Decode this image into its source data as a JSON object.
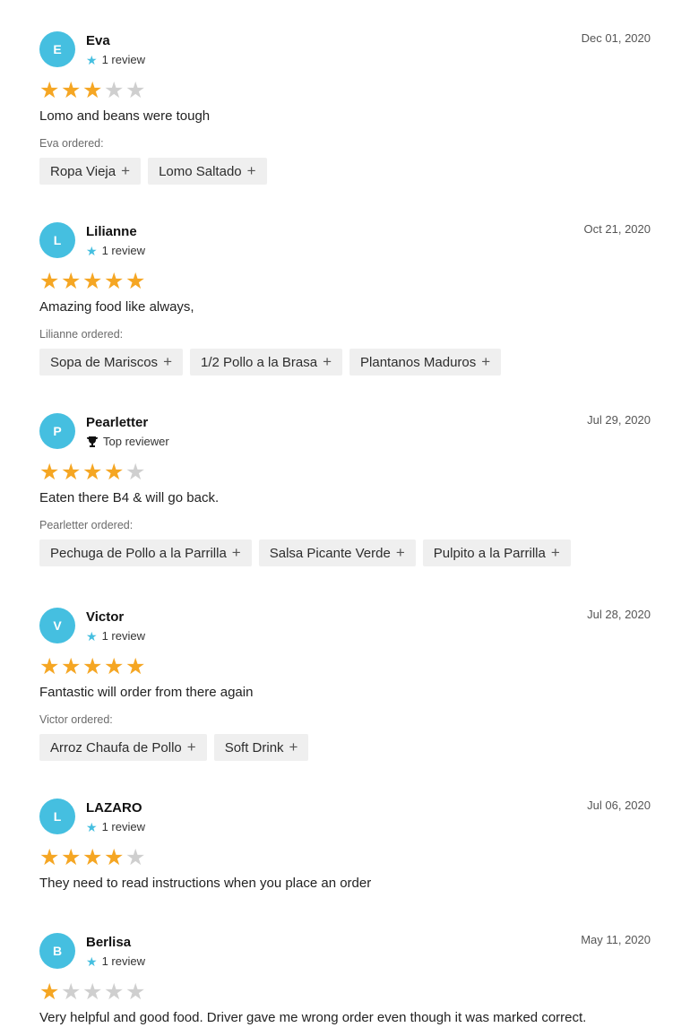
{
  "accent_color": "#45bfe0",
  "star_color": "#f5a623",
  "reviews": [
    {
      "initial": "E",
      "name": "Eva",
      "badge_icon": "star-icon",
      "badge": "1 review",
      "date": "Dec 01, 2020",
      "rating": 3,
      "text": "Lomo and beans were tough",
      "ordered_label": "Eva ordered:",
      "items": [
        "Ropa Vieja",
        "Lomo Saltado"
      ]
    },
    {
      "initial": "L",
      "name": "Lilianne",
      "badge_icon": "star-icon",
      "badge": "1 review",
      "date": "Oct 21, 2020",
      "rating": 5,
      "text": "Amazing food like always,",
      "ordered_label": "Lilianne ordered:",
      "items": [
        "Sopa de Mariscos",
        "1/2 Pollo a la Brasa",
        "Plantanos Maduros"
      ]
    },
    {
      "initial": "P",
      "name": "Pearletter",
      "badge_icon": "trophy-icon",
      "badge": "Top reviewer",
      "date": "Jul 29, 2020",
      "rating": 4,
      "text": "Eaten there B4 & will go back.",
      "ordered_label": "Pearletter ordered:",
      "items": [
        "Pechuga de Pollo a la Parrilla",
        "Salsa Picante Verde",
        "Pulpito a la Parrilla"
      ]
    },
    {
      "initial": "V",
      "name": "Victor",
      "badge_icon": "star-icon",
      "badge": "1 review",
      "date": "Jul 28, 2020",
      "rating": 5,
      "text": "Fantastic will order from there again",
      "ordered_label": "Victor ordered:",
      "items": [
        "Arroz Chaufa de Pollo",
        "Soft Drink"
      ]
    },
    {
      "initial": "L",
      "name": "LAZARO",
      "badge_icon": "star-icon",
      "badge": "1 review",
      "date": "Jul 06, 2020",
      "rating": 4,
      "text": "They need to read instructions when you place an order",
      "ordered_label": "",
      "items": []
    },
    {
      "initial": "B",
      "name": "Berlisa",
      "badge_icon": "star-icon",
      "badge": "1 review",
      "date": "May 11, 2020",
      "rating": 1,
      "text": "Very helpful and good food. Driver gave me wrong order even though it was marked correct.",
      "ordered_label": "",
      "items": []
    }
  ],
  "star_max": 5,
  "plus_glyph": "+"
}
